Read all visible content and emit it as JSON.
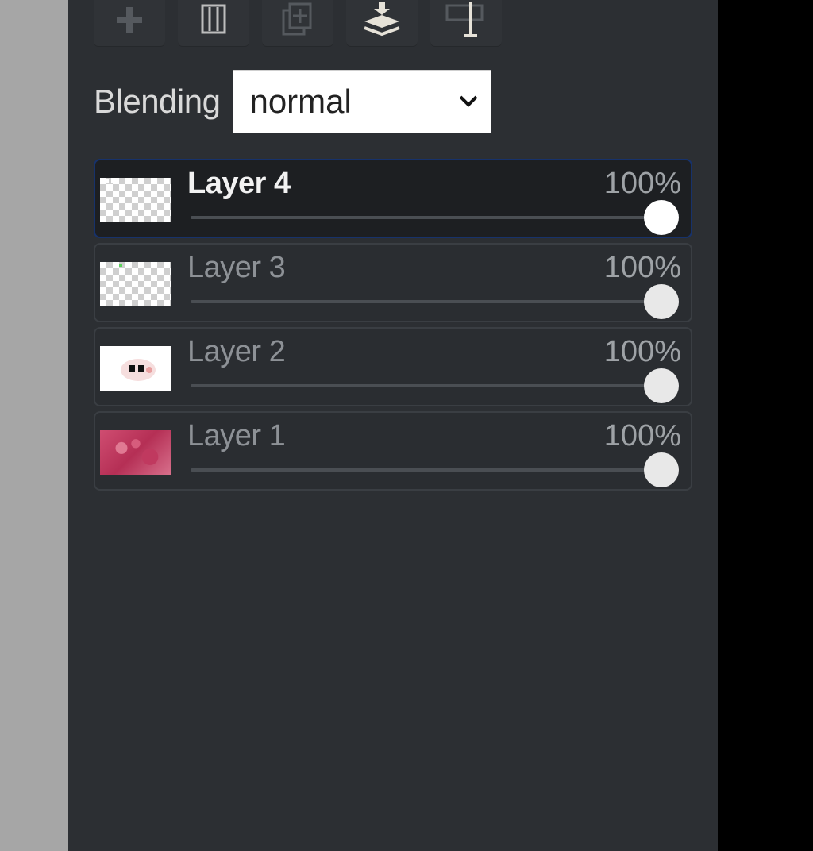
{
  "toolbar": {
    "buttons": [
      {
        "name": "add-layer-button",
        "icon": "plus-icon"
      },
      {
        "name": "delete-layer-button",
        "icon": "trash-icon"
      },
      {
        "name": "duplicate-layer-button",
        "icon": "duplicate-icon"
      },
      {
        "name": "merge-down-button",
        "icon": "merge-layers-icon"
      },
      {
        "name": "layer-properties-button",
        "icon": "text-layer-icon"
      }
    ]
  },
  "blending": {
    "label": "Blending",
    "value": "normal"
  },
  "layers": [
    {
      "name": "Layer 4",
      "opacity_label": "100%",
      "opacity": 1.0,
      "active": true,
      "thumb": "checker-top-marks"
    },
    {
      "name": "Layer 3",
      "opacity_label": "100%",
      "opacity": 1.0,
      "active": false,
      "thumb": "checker"
    },
    {
      "name": "Layer 2",
      "opacity_label": "100%",
      "opacity": 1.0,
      "active": false,
      "thumb": "white-with-eyes"
    },
    {
      "name": "Layer 1",
      "opacity_label": "100%",
      "opacity": 1.0,
      "active": false,
      "thumb": "red-texture"
    }
  ],
  "colors": {
    "panel": "#2c2f33",
    "active_layer_border": "#17326b",
    "canvas_gray": "#a6a6a6"
  }
}
